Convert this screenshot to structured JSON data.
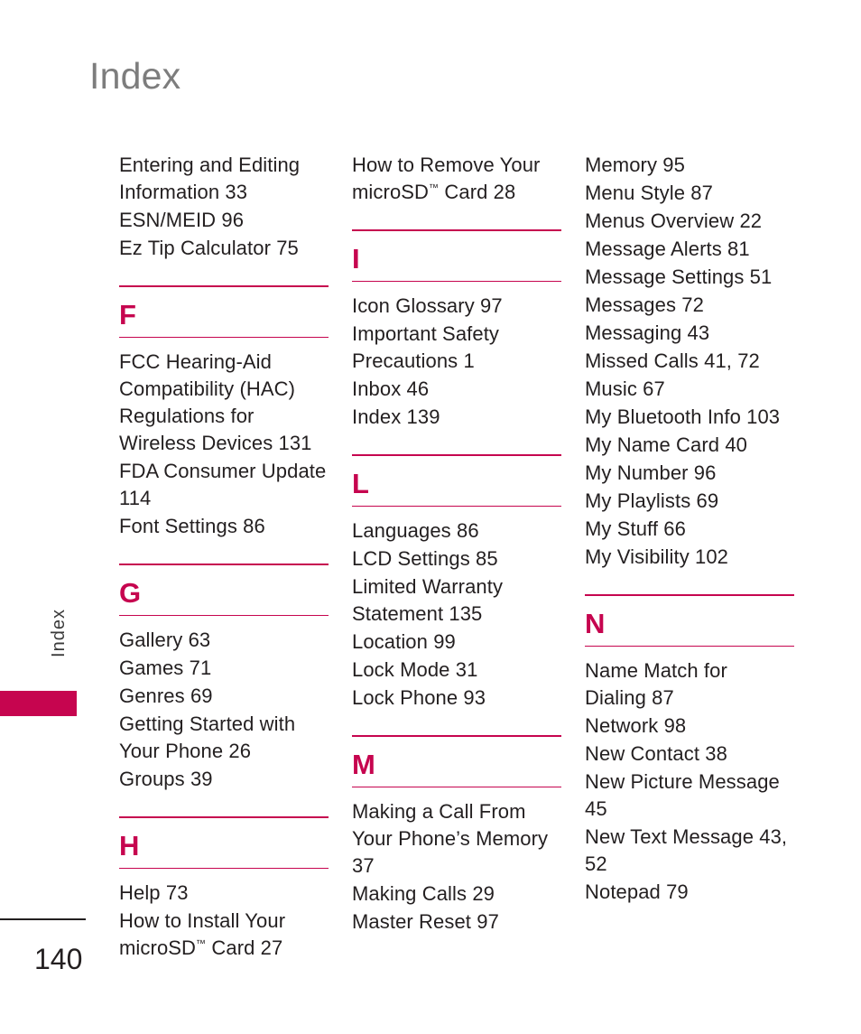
{
  "page": {
    "title": "Index",
    "side_tab_label": "Index",
    "page_number": "140",
    "accent_color": "#C6054F",
    "title_color": "#7D7D7D",
    "text_color": "#231F20"
  },
  "columns": [
    {
      "id": "column-1",
      "blocks": [
        {
          "type": "entries",
          "entries": [
            "Entering and Editing Information 33",
            "ESN/MEID 96",
            "Ez Tip Calculator 75"
          ]
        },
        {
          "type": "section",
          "letter": "F",
          "entries": [
            "FCC Hearing-Aid Compatibility (HAC) Regulations for Wireless Devices 131",
            "FDA Consumer Update 114",
            "Font Settings 86"
          ]
        },
        {
          "type": "section",
          "letter": "G",
          "entries": [
            "Gallery 63",
            "Games 71",
            "Genres 69",
            "Getting Started with Your Phone 26",
            "Groups 39"
          ]
        },
        {
          "type": "section",
          "letter": "H",
          "entries": [
            "Help 73",
            "How to Install Your microSD™ Card 27"
          ]
        }
      ]
    },
    {
      "id": "column-2",
      "blocks": [
        {
          "type": "entries",
          "entries": [
            "How to Remove Your microSD™ Card 28"
          ]
        },
        {
          "type": "section",
          "letter": "I",
          "entries": [
            "Icon Glossary 97",
            "Important Safety Precautions 1",
            "Inbox 46",
            "Index 139"
          ]
        },
        {
          "type": "section",
          "letter": "L",
          "entries": [
            "Languages 86",
            "LCD Settings 85",
            "Limited Warranty Statement 135",
            "Location 99",
            "Lock Mode 31",
            "Lock Phone 93"
          ]
        },
        {
          "type": "section",
          "letter": "M",
          "entries": [
            "Making a Call From Your Phone’s Memory 37",
            "Making Calls 29",
            "Master Reset 97"
          ]
        }
      ]
    },
    {
      "id": "column-3",
      "blocks": [
        {
          "type": "entries",
          "entries": [
            "Memory 95",
            "Menu Style 87",
            "Menus Overview 22",
            "Message Alerts 81",
            "Message Settings 51",
            "Messages 72",
            "Messaging 43",
            "Missed Calls 41, 72",
            "Music 67",
            "My Bluetooth Info 103",
            "My Name Card 40",
            "My Number 96",
            "My Playlists 69",
            "My Stuff 66",
            "My Visibility 102"
          ]
        },
        {
          "type": "section",
          "letter": "N",
          "entries": [
            "Name Match for Dialing 87",
            "Network 98",
            "New Contact 38",
            "New Picture Message 45",
            "New Text Message 43, 52",
            "Notepad 79"
          ]
        }
      ]
    }
  ]
}
